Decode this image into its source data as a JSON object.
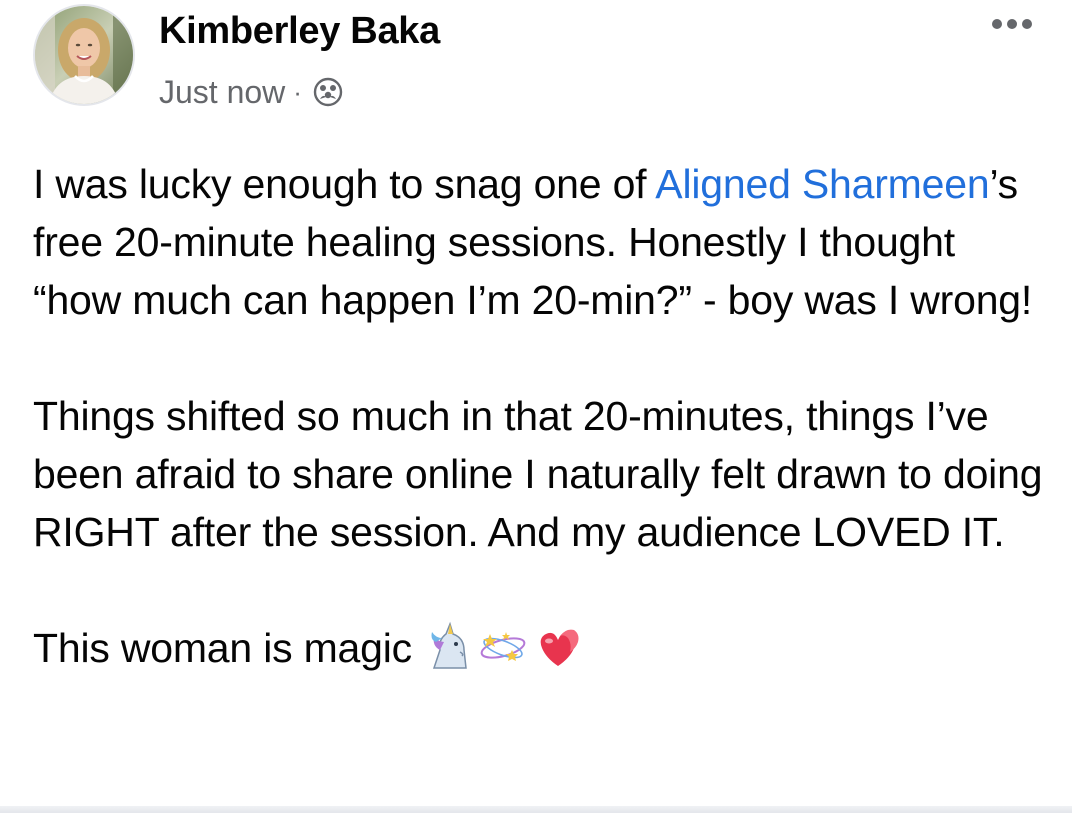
{
  "post": {
    "author": "Kimberley Baka",
    "timestamp": "Just now",
    "separator": "·",
    "privacy_icon": "friends-icon",
    "more_icon": "more-options-icon",
    "paragraph1": {
      "before": "I was lucky enough to snag one of ",
      "mention": "Aligned Sharmeen",
      "after": "’s free 20-minute healing sessions. Honestly I thought “how much can happen I’m 20-min?” - boy was I wrong!"
    },
    "paragraph2": "Things shifted so much in that 20-minutes, things I’ve been afraid to share online I naturally felt drawn to doing RIGHT after the session. And my audience LOVED IT.",
    "paragraph3": "This woman is magic",
    "emojis": [
      "unicorn-emoji",
      "dizzy-stars-emoji",
      "heart-emoji"
    ],
    "colors": {
      "mention": "#216fdb",
      "secondary_text": "#65676b",
      "primary_text": "#050505"
    }
  }
}
